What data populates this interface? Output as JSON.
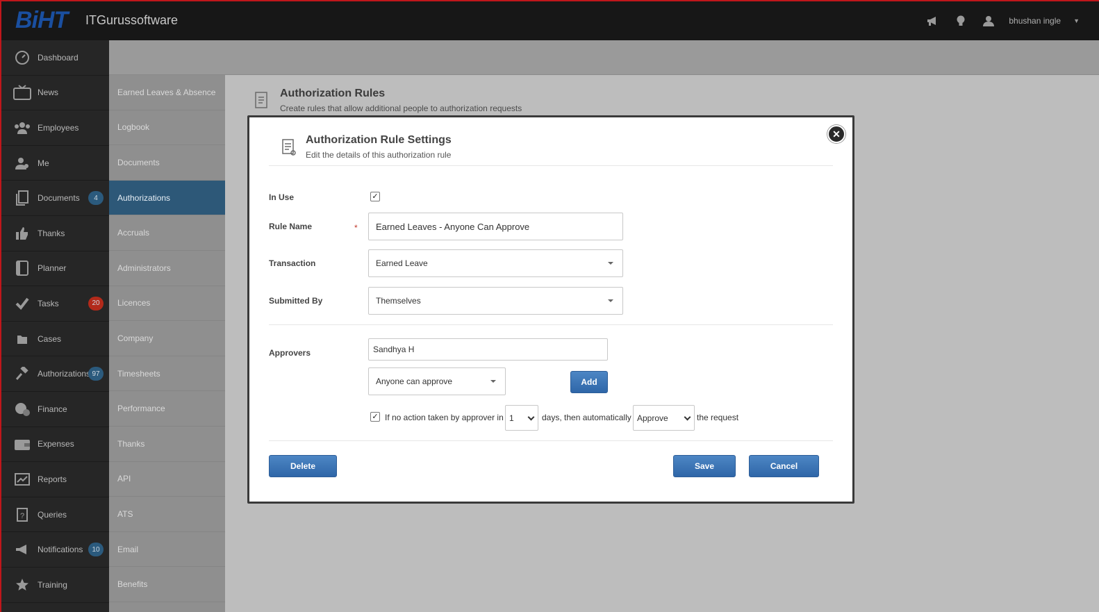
{
  "topbar": {
    "logo": "BiHT",
    "company": "ITGurussoftware",
    "user_name": "bhushan ingle",
    "icons": [
      "megaphone-icon",
      "lightbulb-icon",
      "user-icon",
      "caret-down-icon"
    ]
  },
  "sidebar": {
    "items": [
      {
        "label": "Dashboard",
        "icon": "gauge-icon",
        "badge": ""
      },
      {
        "label": "News",
        "icon": "tv-icon",
        "badge": ""
      },
      {
        "label": "Employees",
        "icon": "users-icon",
        "badge": ""
      },
      {
        "label": "Me",
        "icon": "user-gear-icon",
        "badge": ""
      },
      {
        "label": "Documents",
        "icon": "document-icon",
        "badge": "4",
        "badge_color": "blue"
      },
      {
        "label": "Thanks",
        "icon": "thumbs-up-icon",
        "badge": ""
      },
      {
        "label": "Planner",
        "icon": "planner-icon",
        "badge": ""
      },
      {
        "label": "Tasks",
        "icon": "check-icon",
        "badge": "20",
        "badge_color": "red"
      },
      {
        "label": "Cases",
        "icon": "folder-icon",
        "badge": ""
      },
      {
        "label": "Authorizations",
        "icon": "gavel-icon",
        "badge": "97",
        "badge_color": "blue"
      },
      {
        "label": "Finance",
        "icon": "finance-icon",
        "badge": ""
      },
      {
        "label": "Expenses",
        "icon": "wallet-icon",
        "badge": ""
      },
      {
        "label": "Reports",
        "icon": "chart-icon",
        "badge": ""
      },
      {
        "label": "Queries",
        "icon": "question-icon",
        "badge": ""
      },
      {
        "label": "Notifications",
        "icon": "megaphone-icon",
        "badge": "10",
        "badge_color": "blue"
      },
      {
        "label": "Training",
        "icon": "star-icon",
        "badge": ""
      }
    ]
  },
  "subnav": {
    "items": [
      {
        "label": "Earned Leaves & Absence",
        "active": false
      },
      {
        "label": "Logbook",
        "active": false
      },
      {
        "label": "Documents",
        "active": false
      },
      {
        "label": "Authorizations",
        "active": true
      },
      {
        "label": "Accruals",
        "active": false
      },
      {
        "label": "Administrators",
        "active": false
      },
      {
        "label": "Licences",
        "active": false
      },
      {
        "label": "Company",
        "active": false
      },
      {
        "label": "Timesheets",
        "active": false
      },
      {
        "label": "Performance",
        "active": false
      },
      {
        "label": "Thanks",
        "active": false
      },
      {
        "label": "API",
        "active": false
      },
      {
        "label": "ATS",
        "active": false
      },
      {
        "label": "Email",
        "active": false
      },
      {
        "label": "Benefits",
        "active": false
      }
    ]
  },
  "page": {
    "title": "Authorization Rules",
    "subtitle": "Create rules that allow additional people to authorization requests"
  },
  "modal": {
    "title": "Authorization Rule Settings",
    "subtitle": "Edit the details of this authorization rule",
    "in_use_label": "In Use",
    "in_use_checked": true,
    "rule_name_label": "Rule Name",
    "required_mark": "*",
    "rule_name_value": "Earned Leaves - Anyone Can Approve",
    "transaction_label": "Transaction",
    "transaction_value": "Earned Leave",
    "submitted_by_label": "Submitted By",
    "submitted_by_value": "Themselves",
    "approvers_label": "Approvers",
    "approver_value": "Sandhya H",
    "approval_mode_value": "Anyone can approve",
    "add_label": "Add",
    "auto_checked": true,
    "auto_text_1": "If no action taken by approver in",
    "auto_days_value": "1",
    "auto_text_2": "days, then automatically",
    "auto_action_value": "Approve",
    "auto_text_3": "the request",
    "delete_label": "Delete",
    "save_label": "Save",
    "cancel_label": "Cancel"
  }
}
